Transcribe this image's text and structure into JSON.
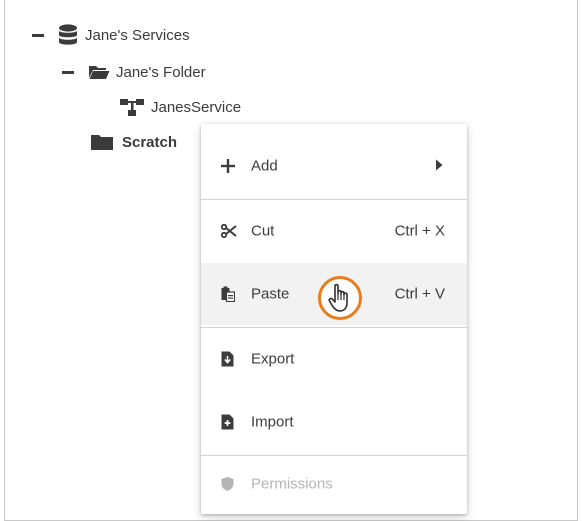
{
  "tree": {
    "root_label": "Jane's Services",
    "folder_label": "Jane's Folder",
    "service_label": "JanesService",
    "scratch_label": "Scratch"
  },
  "context_menu": {
    "add_label": "Add",
    "cut_label": "Cut",
    "cut_shortcut": "Ctrl + X",
    "paste_label": "Paste",
    "paste_shortcut": "Ctrl + V",
    "export_label": "Export",
    "import_label": "Import",
    "permissions_label": "Permissions"
  },
  "icons": {
    "root": "database-icon",
    "folder_open": "folder-open-icon",
    "service": "service-icon",
    "folder": "folder-icon",
    "add": "plus-icon",
    "submenu": "chevron-right-icon",
    "cut": "scissors-icon",
    "paste": "clipboard-icon",
    "export": "file-export-icon",
    "import": "file-import-icon",
    "permissions": "shield-icon",
    "cursor": "hand-pointer-icon"
  },
  "colors": {
    "highlight": "#f2f2f2",
    "cursor_ring": "#e87d1e",
    "text": "#3c3c3c",
    "disabled_text": "#b5b5b5"
  }
}
